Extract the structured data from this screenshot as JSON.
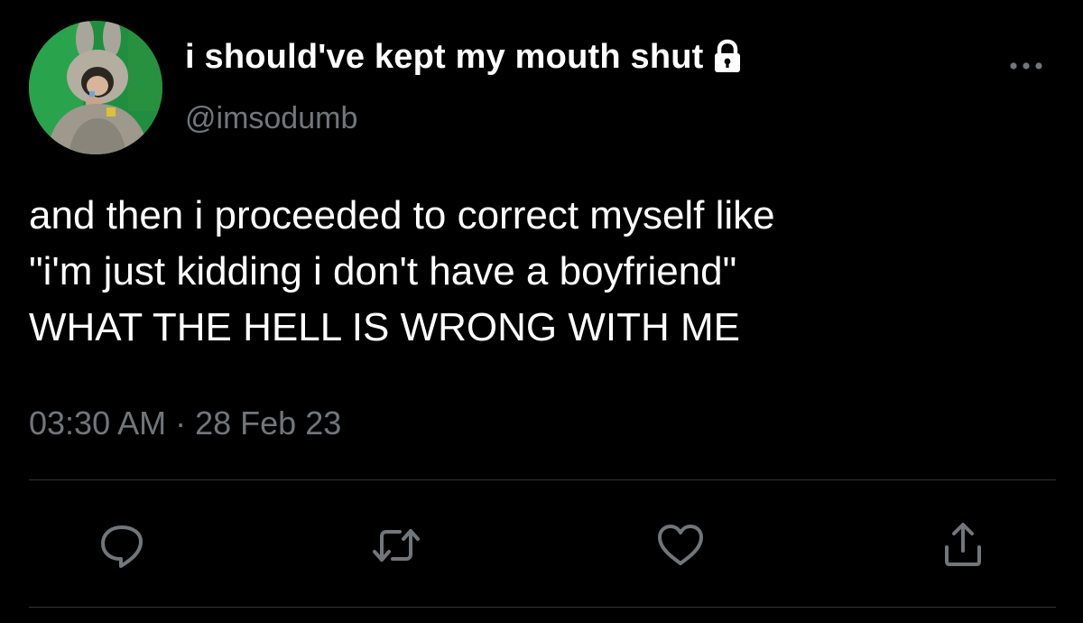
{
  "tweet": {
    "display_name": "i should've kept my mouth shut",
    "handle": "@imsodumb",
    "text_lines": [
      "and then i proceeded to correct myself like",
      "\"i'm just kidding i don't have a boyfriend\"",
      "WHAT THE HELL IS WRONG WITH ME"
    ],
    "time": "03:30 AM",
    "separator": "·",
    "date": "28 Feb 23"
  },
  "icons": {
    "protected": "lock-icon",
    "more": "more-horizontal-icon",
    "reply": "reply-icon",
    "retweet": "retweet-icon",
    "like": "heart-icon",
    "share": "share-icon"
  },
  "colors": {
    "background": "#000000",
    "primary_text": "#ffffff",
    "secondary_text": "#71767b",
    "divider": "#2f3336"
  }
}
